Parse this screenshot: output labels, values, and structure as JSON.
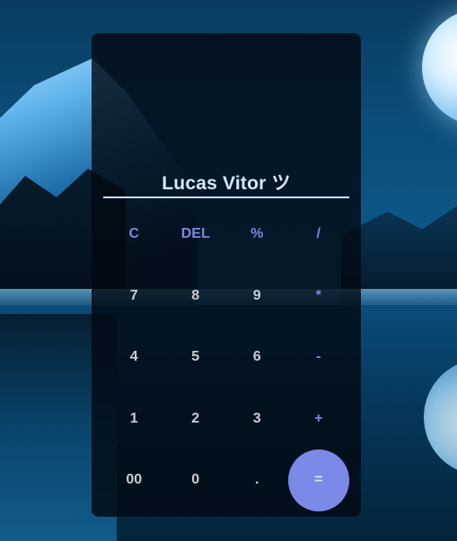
{
  "calculator": {
    "display": "Lucas Vitor ツ",
    "rows": [
      [
        {
          "label": "C",
          "kind": "op"
        },
        {
          "label": "DEL",
          "kind": "op"
        },
        {
          "label": "%",
          "kind": "op"
        },
        {
          "label": "/",
          "kind": "op"
        }
      ],
      [
        {
          "label": "7",
          "kind": "num"
        },
        {
          "label": "8",
          "kind": "num"
        },
        {
          "label": "9",
          "kind": "num"
        },
        {
          "label": "*",
          "kind": "op"
        }
      ],
      [
        {
          "label": "4",
          "kind": "num"
        },
        {
          "label": "5",
          "kind": "num"
        },
        {
          "label": "6",
          "kind": "num"
        },
        {
          "label": "-",
          "kind": "op"
        }
      ],
      [
        {
          "label": "1",
          "kind": "num"
        },
        {
          "label": "2",
          "kind": "num"
        },
        {
          "label": "3",
          "kind": "num"
        },
        {
          "label": "+",
          "kind": "op"
        }
      ],
      [
        {
          "label": "00",
          "kind": "num"
        },
        {
          "label": "0",
          "kind": "num"
        },
        {
          "label": ".",
          "kind": "num"
        },
        {
          "label": "=",
          "kind": "equals"
        }
      ]
    ],
    "colors": {
      "accent": "#7b8ae8",
      "operator_text": "#7a86e6",
      "number_text": "#c8ccd2",
      "display_text": "#d6e6ff",
      "panel": "#020a12"
    }
  }
}
